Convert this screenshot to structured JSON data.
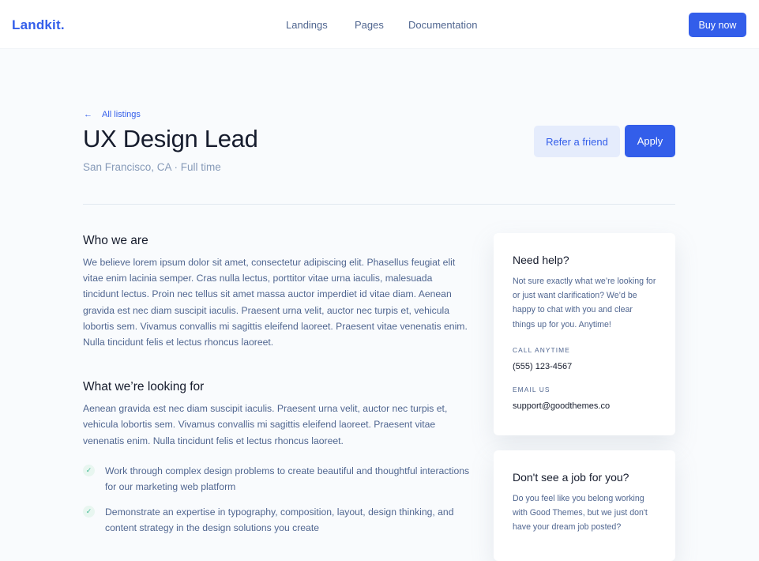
{
  "nav": {
    "brand": "Landkit.",
    "links": [
      "Landings",
      "Pages",
      "Documentation"
    ],
    "cta": "Buy now"
  },
  "header": {
    "back_label": "All listings",
    "title": "UX Design Lead",
    "meta": "San Francisco, CA · Full time",
    "refer_label": "Refer a friend",
    "apply_label": "Apply"
  },
  "content": {
    "who_heading": "Who we are",
    "who_text": "We believe lorem ipsum dolor sit amet, consectetur adipiscing elit. Phasellus feugiat elit vitae enim lacinia semper. Cras nulla lectus, porttitor vitae urna iaculis, malesuada tincidunt lectus. Proin nec tellus sit amet massa auctor imperdiet id vitae diam. Aenean gravida est nec diam suscipit iaculis. Praesent urna velit, auctor nec turpis et, vehicula lobortis sem. Vivamus convallis mi sagittis eleifend laoreet. Praesent vitae venenatis enim. Nulla tincidunt felis et lectus rhoncus laoreet.",
    "looking_heading": "What we’re looking for",
    "looking_text": "Aenean gravida est nec diam suscipit iaculis. Praesent urna velit, auctor nec turpis et, vehicula lobortis sem. Vivamus convallis mi sagittis eleifend laoreet. Praesent vitae venenatis enim. Nulla tincidunt felis et lectus rhoncus laoreet.",
    "checklist": [
      "Work through complex design problems to create beautiful and thoughtful interactions for our marketing web platform",
      "Demonstrate an expertise in typography, composition, layout, design thinking, and content strategy in the design solutions you create"
    ]
  },
  "help_card": {
    "title": "Need help?",
    "text": "Not sure exactly what we’re looking for or just want clarification? We’d be happy to chat with you and clear things up for you. Anytime!",
    "call_label": "Call anytime",
    "phone": "(555) 123-4567",
    "email_label": "Email us",
    "email": "support@goodthemes.co"
  },
  "job_card": {
    "title": "Don't see a job for you?",
    "text": "Do you feel like you belong working with Good Themes, but we just don't have your dream job posted?"
  },
  "colors": {
    "primary": "#335eea",
    "primary_soft": "#e5ecfc",
    "success": "#42ba96",
    "text_muted": "#506690",
    "background": "#f9fbfd"
  }
}
